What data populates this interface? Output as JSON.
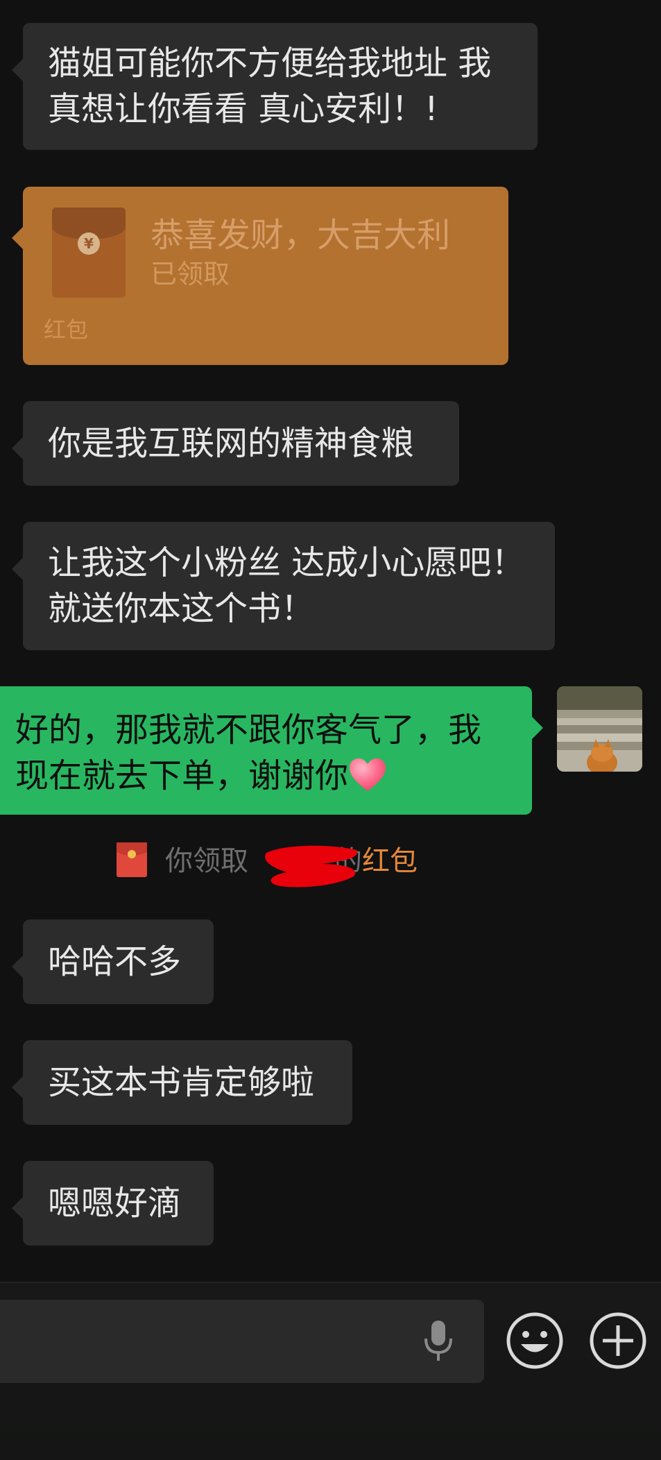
{
  "messages": {
    "m1": {
      "text": "猫姐可能你不方便给我地址 我\n真想让你看看 真心安利！!"
    },
    "red_packet": {
      "title": "恭喜发财，大吉大利",
      "status": "已领取",
      "label": "红包"
    },
    "m2": {
      "text": "你是我互联网的精神食粮"
    },
    "m3": {
      "text": "让我这个小粉丝 达成小心愿吧！\n就送你本这个书！"
    },
    "mine": {
      "text": "好的，那我就不跟你客气了，我\n现在就去下单，谢谢你"
    },
    "system": {
      "prefix": "你领取",
      "suffix": "的",
      "link": "红包"
    },
    "m4": {
      "text": "哈哈不多"
    },
    "m5": {
      "text": "买这本书肯定够啦"
    },
    "m6": {
      "text": "嗯嗯好滴"
    }
  },
  "icons": {
    "voice": "microphone-icon",
    "emoji": "smiley-icon",
    "more": "plus-circle-icon",
    "heart": "heart-emoji",
    "red_packet": "red-envelope-icon"
  },
  "colors": {
    "background": "#111111",
    "incoming_bubble": "#2c2c2c",
    "outgoing_bubble": "#28b760",
    "red_packet": "#b3722f",
    "link": "#e5893a"
  }
}
